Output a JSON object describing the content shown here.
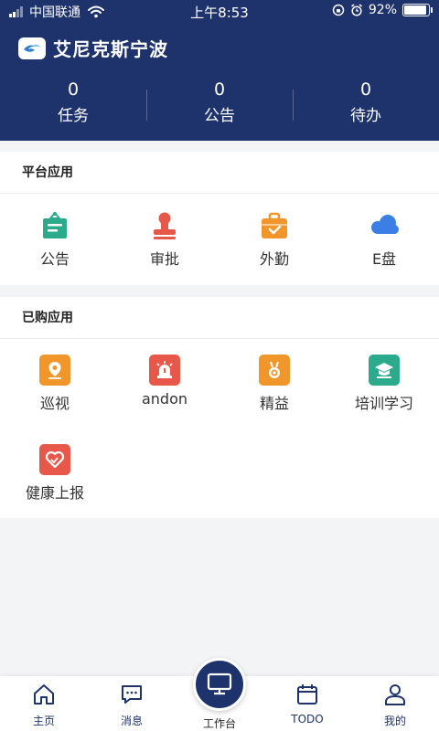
{
  "status_bar": {
    "carrier": "中国联通",
    "time": "上午8:53",
    "battery": "92%",
    "battery_level": 0.92
  },
  "header": {
    "company_name": "艾尼克斯宁波",
    "stats": [
      {
        "value": "0",
        "label": "任务"
      },
      {
        "value": "0",
        "label": "公告"
      },
      {
        "value": "0",
        "label": "待办"
      }
    ]
  },
  "platform_apps": {
    "title": "平台应用",
    "items": [
      {
        "label": "公告",
        "icon": "announcement-board-icon",
        "color": "#2bab8c"
      },
      {
        "label": "审批",
        "icon": "stamp-icon",
        "color": "#e8584a"
      },
      {
        "label": "外勤",
        "icon": "briefcase-icon",
        "color": "#f0962a"
      },
      {
        "label": "E盘",
        "icon": "cloud-icon",
        "color": "#3b7fe6"
      }
    ]
  },
  "purchased_apps": {
    "title": "已购应用",
    "items": [
      {
        "label": "巡视",
        "icon": "location-pin-icon",
        "color": "#f0962a"
      },
      {
        "label": "andon",
        "icon": "alarm-light-icon",
        "color": "#e8584a"
      },
      {
        "label": "精益",
        "icon": "medal-icon",
        "color": "#f0962a"
      },
      {
        "label": "培训学习",
        "icon": "graduation-cap-icon",
        "color": "#2bab8c"
      },
      {
        "label": "健康上报",
        "icon": "heart-icon",
        "color": "#e8584a"
      }
    ]
  },
  "tabbar": {
    "items": [
      {
        "label": "主页",
        "icon": "home-icon"
      },
      {
        "label": "消息",
        "icon": "message-icon"
      },
      {
        "label": "工作台",
        "icon": "monitor-icon"
      },
      {
        "label": "TODO",
        "icon": "calendar-icon"
      },
      {
        "label": "我的",
        "icon": "profile-icon"
      }
    ]
  },
  "colors": {
    "primary": "#1e336b",
    "background": "#f3f4f6"
  }
}
